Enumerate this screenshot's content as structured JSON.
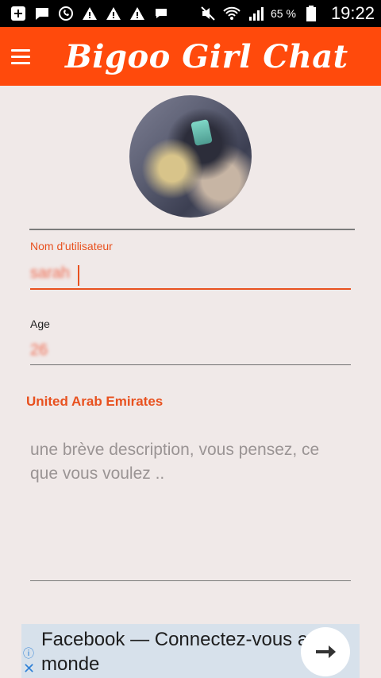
{
  "status_bar": {
    "battery_percent": "65 %",
    "time": "19:22",
    "left_icons": [
      "add-box-icon",
      "chat-icon",
      "whatsapp-icon",
      "warning-icon",
      "warning-icon",
      "warning-icon",
      "message-icon"
    ],
    "right_icons": [
      "mute-icon",
      "wifi-icon",
      "signal-icon",
      "battery-icon"
    ]
  },
  "app_bar": {
    "title": "Bigoo Girl Chat",
    "color": "#ff4a0c"
  },
  "form": {
    "username_label": "Nom d'utilisateur",
    "username_value": "sarah",
    "age_label": "Age",
    "age_value": "26",
    "country": "United Arab Emirates",
    "description_placeholder": "une brève description, vous pensez, ce que vous voulez .."
  },
  "ad": {
    "text": "Facebook — Connectez-vous au monde"
  },
  "colors": {
    "accent": "#e8511f",
    "background": "#f0e9e8"
  }
}
